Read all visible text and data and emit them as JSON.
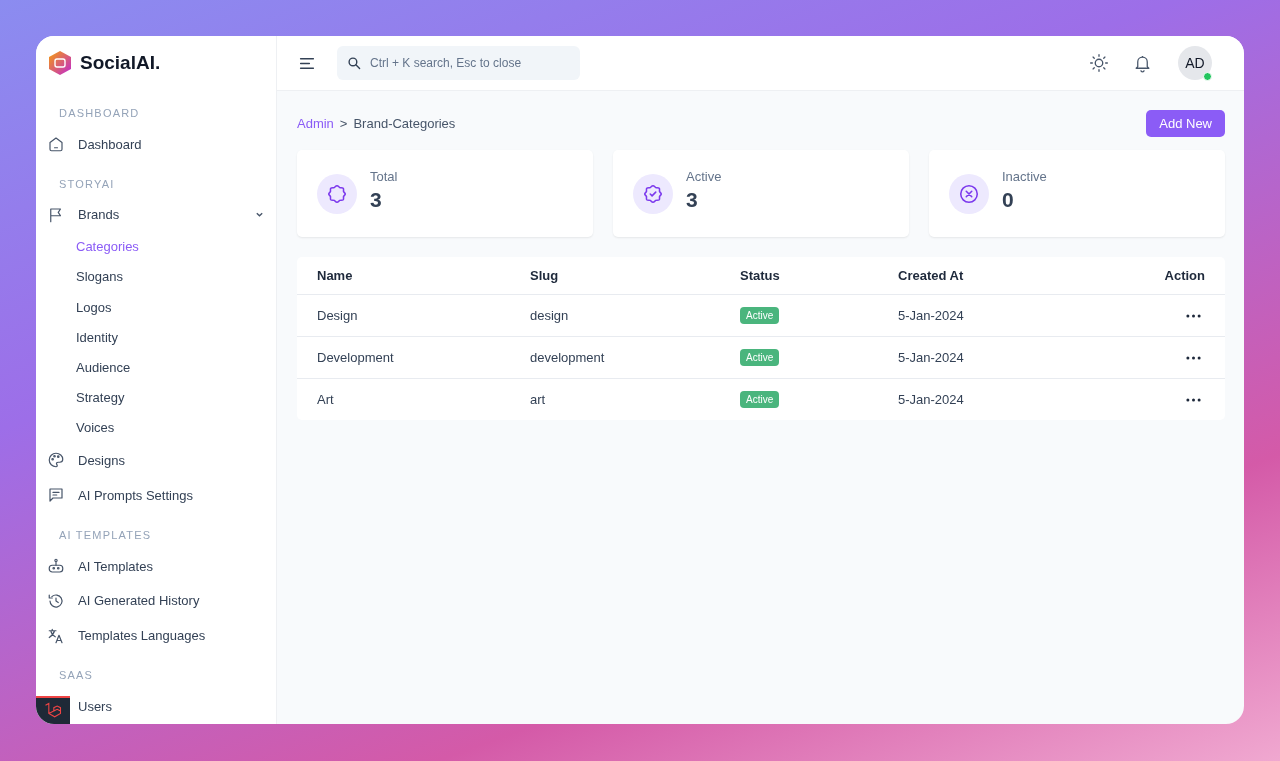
{
  "brand": {
    "name": "SocialAI."
  },
  "search": {
    "placeholder": "Ctrl + K search, Esc to close"
  },
  "user": {
    "initials": "AD",
    "online": true
  },
  "sidebar": {
    "sections": [
      {
        "title": "DASHBOARD",
        "items": [
          {
            "label": "Dashboard",
            "selected": false
          }
        ]
      },
      {
        "title": "STORYAI",
        "items": [
          {
            "label": "Brands",
            "selected": false,
            "expanded": true,
            "children": [
              {
                "label": "Categories",
                "selected": true
              },
              {
                "label": "Slogans",
                "selected": false
              },
              {
                "label": "Logos",
                "selected": false
              },
              {
                "label": "Identity",
                "selected": false
              },
              {
                "label": "Audience",
                "selected": false
              },
              {
                "label": "Strategy",
                "selected": false
              },
              {
                "label": "Voices",
                "selected": false
              }
            ]
          },
          {
            "label": "Designs",
            "selected": false
          },
          {
            "label": "AI Prompts Settings",
            "selected": false
          }
        ]
      },
      {
        "title": "AI TEMPLATES",
        "items": [
          {
            "label": "AI Templates",
            "selected": false
          },
          {
            "label": "AI Generated History",
            "selected": false
          },
          {
            "label": "Templates Languages",
            "selected": false
          }
        ]
      },
      {
        "title": "SAAS",
        "items": [
          {
            "label": "Users",
            "selected": false
          }
        ]
      }
    ]
  },
  "breadcrumb": [
    {
      "label": "Admin",
      "link": true
    },
    {
      "label": ">",
      "link": false
    },
    {
      "label": "Brand-Categories",
      "link": false
    }
  ],
  "add_button": "Add New",
  "stats": [
    {
      "label": "Total",
      "value": "3"
    },
    {
      "label": "Active",
      "value": "3"
    },
    {
      "label": "Inactive",
      "value": "0"
    }
  ],
  "table": {
    "columns": [
      "Name",
      "Slug",
      "Status",
      "Created At",
      "Action"
    ],
    "rows": [
      {
        "name": "Design",
        "slug": "design",
        "status": "Active",
        "created": "5-Jan-2024"
      },
      {
        "name": "Development",
        "slug": "development",
        "status": "Active",
        "created": "5-Jan-2024"
      },
      {
        "name": "Art",
        "slug": "art",
        "status": "Active",
        "created": "5-Jan-2024"
      }
    ]
  }
}
